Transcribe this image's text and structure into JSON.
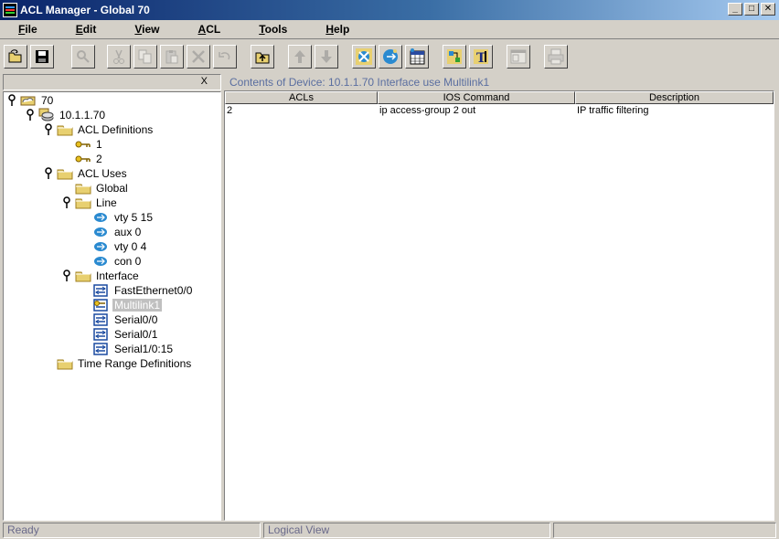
{
  "window": {
    "title": "ACL Manager - Global 70",
    "minimize_glyph": "_",
    "maximize_glyph": "□",
    "close_glyph": "✕"
  },
  "menu": [
    "File",
    "Edit",
    "View",
    "ACL",
    "Tools",
    "Help"
  ],
  "toolbar": {
    "buttons": [
      {
        "name": "open-icon",
        "enabled": true
      },
      {
        "name": "save-icon",
        "enabled": true
      },
      {
        "name": "find-icon",
        "enabled": false
      },
      {
        "name": "cut-icon",
        "enabled": false
      },
      {
        "name": "copy-icon",
        "enabled": false
      },
      {
        "name": "paste-icon",
        "enabled": false
      },
      {
        "name": "delete-icon",
        "enabled": false
      },
      {
        "name": "undo-icon",
        "enabled": false
      },
      {
        "name": "up-level-icon",
        "enabled": true
      },
      {
        "name": "move-up-icon",
        "enabled": false
      },
      {
        "name": "move-down-icon",
        "enabled": false
      },
      {
        "name": "acl-wizard-icon",
        "enabled": true
      },
      {
        "name": "deploy-icon",
        "enabled": true
      },
      {
        "name": "schedule-icon",
        "enabled": true
      },
      {
        "name": "topology-icon",
        "enabled": true
      },
      {
        "name": "text-editor-icon",
        "enabled": true
      },
      {
        "name": "window-icon",
        "enabled": false
      },
      {
        "name": "print-icon",
        "enabled": false
      }
    ]
  },
  "left_panel": {
    "close_label": "X",
    "tree": [
      {
        "label": "70",
        "icon": "cloud-icon"
      },
      {
        "label": "10.1.1.70",
        "icon": "router-icon"
      },
      {
        "label": "ACL Definitions",
        "icon": "folder-icon"
      },
      {
        "label": "1",
        "icon": "key-icon"
      },
      {
        "label": "2",
        "icon": "key-icon"
      },
      {
        "label": "ACL Uses",
        "icon": "folder-icon"
      },
      {
        "label": "Global",
        "icon": "folder-icon"
      },
      {
        "label": "Line",
        "icon": "folder-icon"
      },
      {
        "label": "vty 5 15",
        "icon": "line-icon"
      },
      {
        "label": "aux 0",
        "icon": "line-icon"
      },
      {
        "label": "vty 0 4",
        "icon": "line-icon"
      },
      {
        "label": "con 0",
        "icon": "line-icon"
      },
      {
        "label": "Interface",
        "icon": "folder-icon"
      },
      {
        "label": "FastEthernet0/0",
        "icon": "interface-icon"
      },
      {
        "label": "Multilink1",
        "icon": "interface-key-icon",
        "selected": true
      },
      {
        "label": "Serial0/0",
        "icon": "interface-icon"
      },
      {
        "label": "Serial0/1",
        "icon": "interface-icon"
      },
      {
        "label": "Serial1/0:15",
        "icon": "interface-icon"
      },
      {
        "label": "Time Range Definitions",
        "icon": "folder-icon"
      }
    ]
  },
  "right_panel": {
    "contents_label": "Contents of  Device: 10.1.1.70  Interface use Multilink1",
    "columns": [
      "ACLs",
      "IOS Command",
      "Description"
    ],
    "rows": [
      [
        "2",
        "ip access-group 2 out",
        "IP traffic filtering"
      ]
    ]
  },
  "status": {
    "left": "Ready",
    "middle": "Logical View",
    "right": ""
  }
}
